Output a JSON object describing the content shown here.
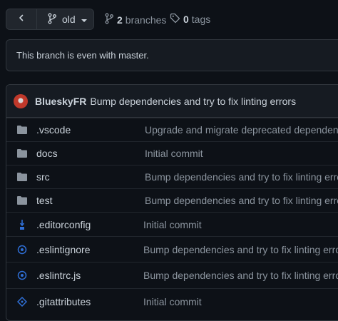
{
  "toolbar": {
    "branch_name": "old",
    "branches_count": "2",
    "branches_label": "branches",
    "tags_count": "0",
    "tags_label": "tags"
  },
  "status": {
    "message": "This branch is even with master."
  },
  "latest_commit": {
    "author": "BlueskyFR",
    "message": "Bump dependencies and try to fix linting errors"
  },
  "files": [
    {
      "name": ".vscode",
      "type": "folder",
      "commit": "Upgrade and migrate deprecated dependencies"
    },
    {
      "name": "docs",
      "type": "folder",
      "commit": "Initial commit"
    },
    {
      "name": "src",
      "type": "folder",
      "commit": "Bump dependencies and try to fix linting errors"
    },
    {
      "name": "test",
      "type": "folder",
      "commit": "Bump dependencies and try to fix linting errors"
    },
    {
      "name": ".editorconfig",
      "type": "editorconfig-file",
      "commit": "Initial commit"
    },
    {
      "name": ".eslintignore",
      "type": "eslint-file",
      "commit": "Bump dependencies and try to fix linting errors"
    },
    {
      "name": ".eslintrc.js",
      "type": "eslint-file",
      "commit": "Bump dependencies and try to fix linting errors"
    },
    {
      "name": ".gitattributes",
      "type": "git-file",
      "commit": "Initial commit"
    }
  ],
  "colors": {
    "background": "#0d1117",
    "panel": "#161b22",
    "border": "#30363d",
    "text": "#c9d1d9",
    "muted": "#8b949e",
    "folder_icon": "#8b949e",
    "file_icon_blue": "#2f6fd6"
  }
}
